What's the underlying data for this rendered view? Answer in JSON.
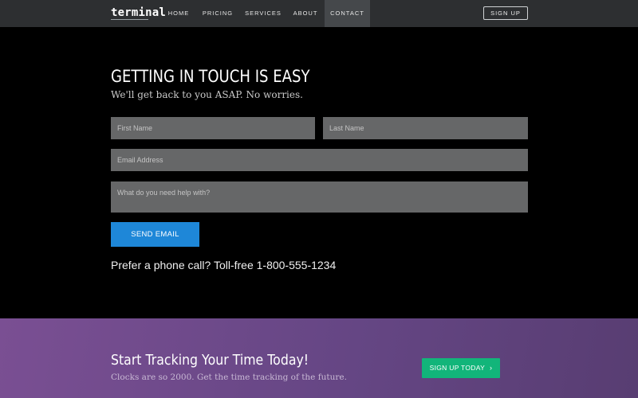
{
  "nav": {
    "logo": "terminal",
    "items": [
      {
        "label": "HOME"
      },
      {
        "label": "PRICING"
      },
      {
        "label": "SERVICES"
      },
      {
        "label": "ABOUT"
      },
      {
        "label": "CONTACT",
        "active": true
      }
    ],
    "signup_label": "SIGN UP"
  },
  "contact": {
    "title": "GETTING IN TOUCH IS EASY",
    "subtitle": "We'll get back to you ASAP. No worries.",
    "fields": {
      "first_name_placeholder": "First Name",
      "last_name_placeholder": "Last Name",
      "email_placeholder": "Email Address",
      "message_placeholder": "What do you need help with?"
    },
    "send_label": "SEND EMAIL",
    "phone_text": "Prefer a phone call? Toll-free 1-800-555-1234"
  },
  "banner": {
    "title": "Start Tracking Your Time Today!",
    "subtitle": "Clocks are so 2000. Get the time tracking of the future.",
    "cta_label": "SIGN UP TODAY",
    "cta_icon": "chevron-right-icon"
  },
  "colors": {
    "nav_bg": "#2d2f31",
    "primary_button": "#1e87d8",
    "cta_button": "#12b57a",
    "banner_purple": "#6b4888"
  }
}
